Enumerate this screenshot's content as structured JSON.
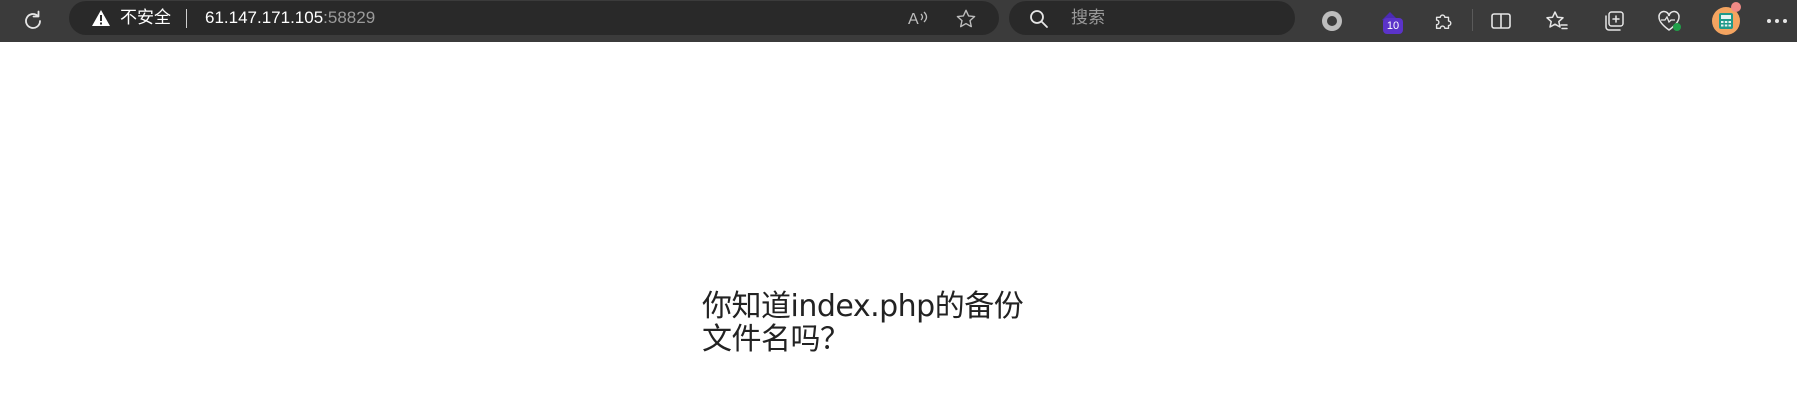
{
  "browser": {
    "address_bar": {
      "security_label": "不安全",
      "host": "61.147.171.105",
      "port": ":58829"
    },
    "search": {
      "placeholder": "搜索"
    },
    "extension_badge_count": "10",
    "icons": {
      "reload": "reload-icon",
      "warning": "warning-icon",
      "read_aloud": "read-aloud-icon",
      "favorite": "favorite-star-icon",
      "search": "search-icon",
      "record": "record-icon",
      "extension_shortcut": "extension-shortcut-icon",
      "extensions": "puzzle-icon",
      "split_screen": "split-screen-icon",
      "favorites": "favorites-icon",
      "collections": "collections-icon",
      "health": "browser-essentials-icon",
      "profile": "profile-avatar-icon",
      "menu": "more-menu-icon"
    },
    "colors": {
      "toolbar": "#3b3b3b",
      "field": "#292929",
      "badge": "#5b33c9"
    }
  },
  "page": {
    "message": "你知道index.php的备份文件名吗？"
  }
}
